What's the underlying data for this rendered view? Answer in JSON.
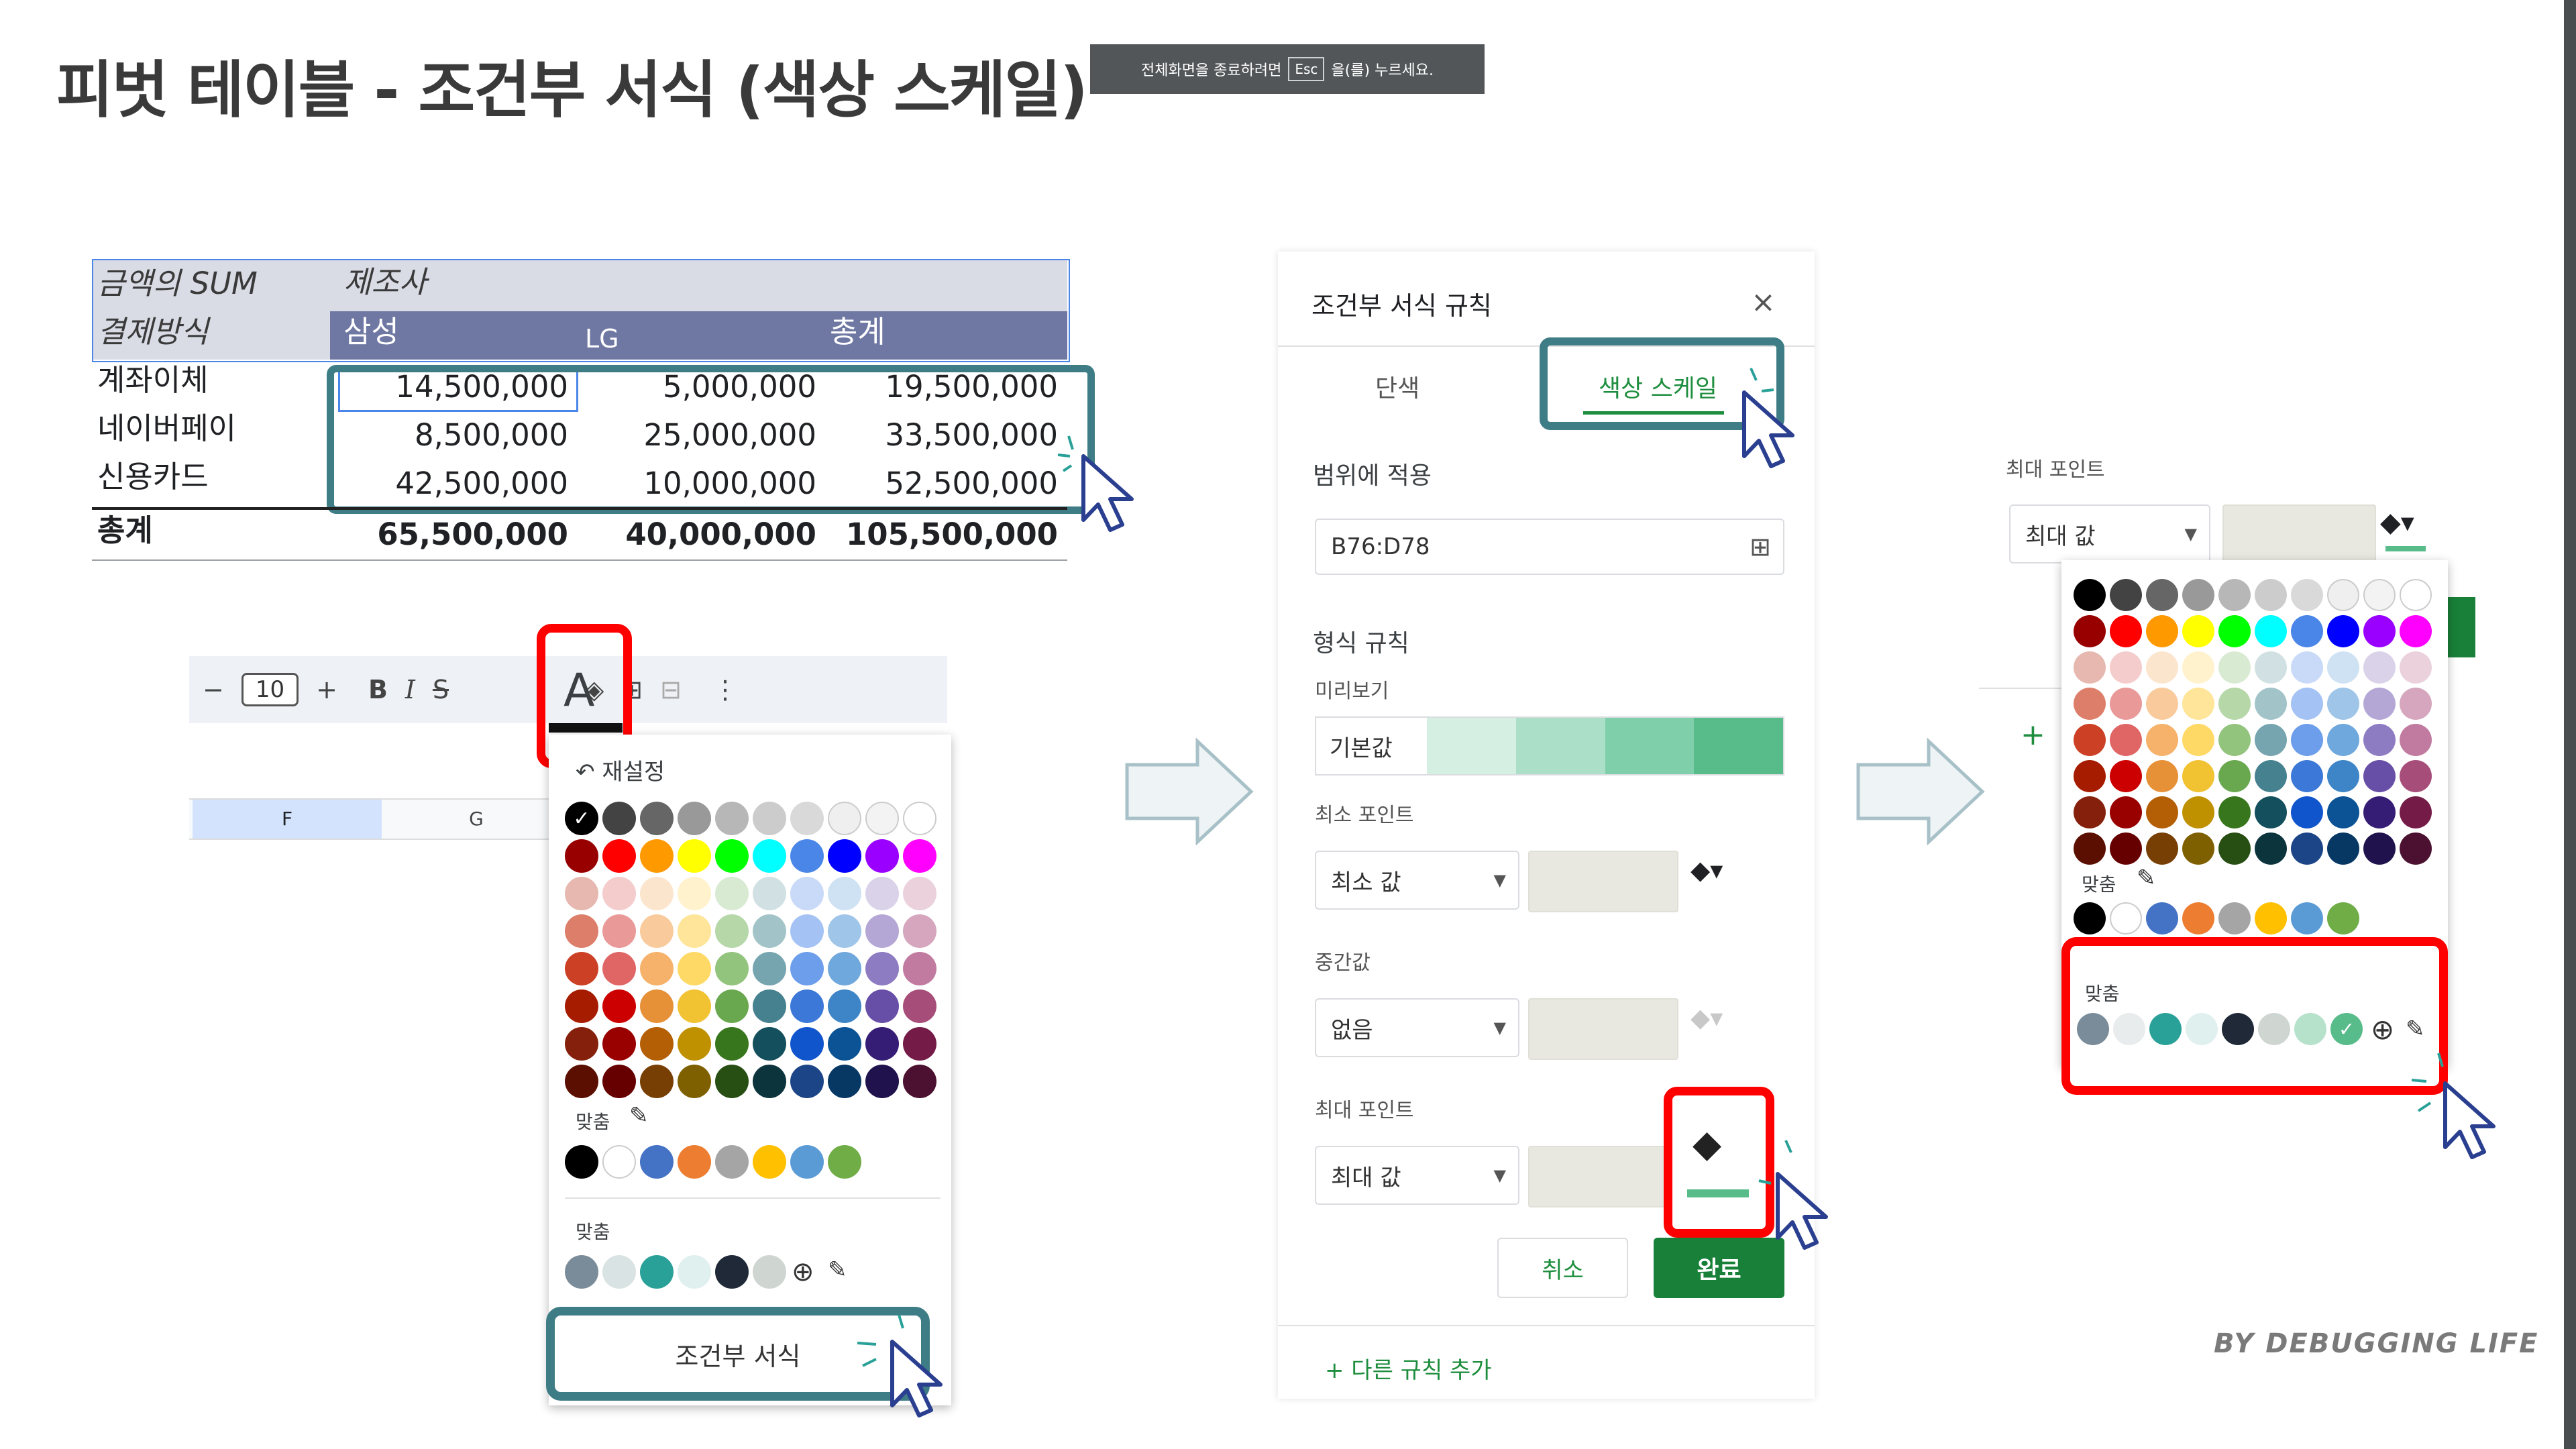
{
  "title": "피벗 테이블 - 조건부 서식 (색상 스케일)",
  "esc_banner": {
    "before": "전체화면을 종료하려면",
    "key": "Esc",
    "after": "을(를) 누르세요."
  },
  "pivot": {
    "corner_label": "금액의 SUM",
    "column_field": "제조사",
    "row_field": "결제방식",
    "columns": [
      "삼성",
      "LG",
      "총계"
    ],
    "rows": [
      {
        "label": "계좌이체",
        "values": [
          "14,500,000",
          "5,000,000",
          "19,500,000"
        ]
      },
      {
        "label": "네이버페이",
        "values": [
          "8,500,000",
          "25,000,000",
          "33,500,000"
        ]
      },
      {
        "label": "신용카드",
        "values": [
          "42,500,000",
          "10,000,000",
          "52,500,000"
        ]
      }
    ],
    "total": {
      "label": "총계",
      "values": [
        "65,500,000",
        "40,000,000",
        "105,500,000"
      ]
    }
  },
  "toolbar": {
    "minus": "−",
    "font_size": "10",
    "plus": "+",
    "bold": "B",
    "italic": "I",
    "strike": "S",
    "text_color": "A",
    "fill": "◈",
    "borders": "⊞",
    "merge": "⊟",
    "more": "⋮"
  },
  "columns_header": {
    "f": "F",
    "g": "G"
  },
  "left_palette": {
    "reset": "재설정",
    "custom_label_1": "맞춤",
    "custom_label_2": "맞춤",
    "cond_format_button": "조건부 서식"
  },
  "palette_colors": {
    "base": [
      "#000000",
      "#434343",
      "#666666",
      "#999999",
      "#b7b7b7",
      "#cccccc",
      "#d9d9d9",
      "#efefef",
      "#f3f3f3",
      "#ffffff"
    ],
    "bright": [
      "#980000",
      "#ff0000",
      "#ff9900",
      "#ffff00",
      "#00ff00",
      "#00ffff",
      "#4a86e8",
      "#0000ff",
      "#9900ff",
      "#ff00ff"
    ],
    "tints": [
      [
        "#e6b8af",
        "#f4cccc",
        "#fce5cd",
        "#fff2cc",
        "#d9ead3",
        "#d0e0e3",
        "#c9daf8",
        "#cfe2f3",
        "#d9d2e9",
        "#ead1dc"
      ],
      [
        "#dd7e6b",
        "#ea9999",
        "#f9cb9c",
        "#ffe599",
        "#b6d7a8",
        "#a2c4c9",
        "#a4c2f4",
        "#9fc5e8",
        "#b4a7d6",
        "#d5a6bd"
      ],
      [
        "#cc4125",
        "#e06666",
        "#f6b26b",
        "#ffd966",
        "#93c47d",
        "#76a5af",
        "#6d9eeb",
        "#6fa8dc",
        "#8e7cc3",
        "#c27ba0"
      ],
      [
        "#a61c00",
        "#cc0000",
        "#e69138",
        "#f1c232",
        "#6aa84f",
        "#45818e",
        "#3c78d8",
        "#3d85c6",
        "#674ea7",
        "#a64d79"
      ],
      [
        "#85200c",
        "#990000",
        "#b45f06",
        "#bf9000",
        "#38761d",
        "#134f5c",
        "#1155cc",
        "#0b5394",
        "#351c75",
        "#741b47"
      ],
      [
        "#5b0f00",
        "#660000",
        "#783f04",
        "#7f6000",
        "#274e13",
        "#0c343d",
        "#1c4587",
        "#073763",
        "#20124d",
        "#4c1130"
      ]
    ],
    "theme": [
      "#000000",
      "#ffffff",
      "#4472c4",
      "#ed7d31",
      "#a5a5a5",
      "#ffc000",
      "#5b9bd5",
      "#70ad47"
    ],
    "custom_left": [
      "#7a8c99",
      "#d9e3e3",
      "#2aa198",
      "#e0f0ee",
      "#1f2937",
      "#cfd6d2"
    ],
    "custom_right": [
      "#7a8c99",
      "#e8ecec",
      "#2aa198",
      "#e0f0ee",
      "#1f2937",
      "#cfd6d2",
      "#b6e2cc",
      "#57bb8a"
    ]
  },
  "cf_panel": {
    "title": "조건부 서식 규칙",
    "close": "×",
    "tab_single": "단색",
    "tab_scale": "색상 스케일",
    "apply_range_label": "범위에 적용",
    "range_value": "B76:D78",
    "format_rules_label": "형식 규칙",
    "preview_label": "미리보기",
    "preview_default": "기본값",
    "preview_colors": [
      "#d6efe3",
      "#abdfc7",
      "#80cfab",
      "#57bb8a"
    ],
    "min_label": "최소 포인트",
    "min_value": "최소 값",
    "mid_label": "중간값",
    "mid_value": "없음",
    "max_label": "최대 포인트",
    "max_value": "최대 값",
    "cancel": "취소",
    "done": "완료",
    "add_rule": "+ 다른 규칙 추가"
  },
  "right_panel": {
    "max_label": "최대 포인트",
    "max_value": "최대 값",
    "custom_label_1": "맞춤",
    "custom_label_2": "맞춤",
    "plus": "+"
  },
  "signature": "BY DEBUGGING LIFE",
  "colors": {
    "highlight_red": "#ff0000",
    "highlight_teal": "#3f7d86",
    "done_green": "#188038",
    "scale_green": "#57bb8a"
  }
}
